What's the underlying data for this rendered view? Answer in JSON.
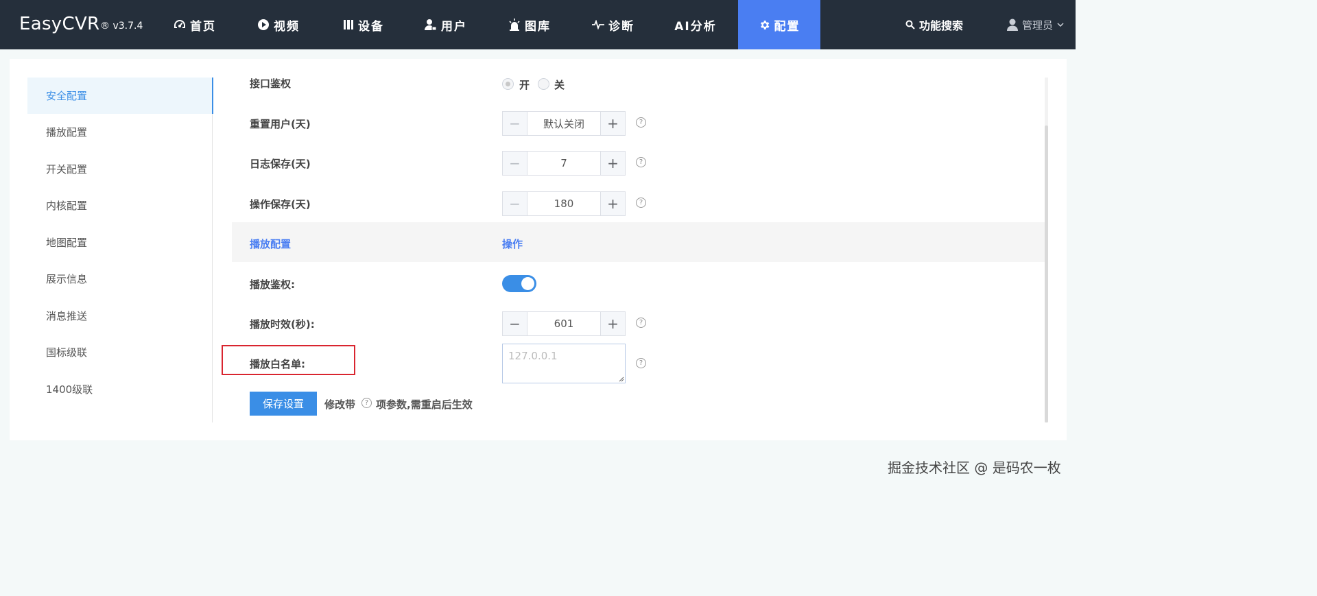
{
  "brand": {
    "name": "EasyCVR",
    "version": "® v3.7.4"
  },
  "nav": {
    "items": [
      {
        "label": "首页",
        "icon": "dashboard-icon"
      },
      {
        "label": "视频",
        "icon": "play-circle-icon"
      },
      {
        "label": "设备",
        "icon": "device-columns-icon"
      },
      {
        "label": "用户",
        "icon": "user-lock-icon"
      },
      {
        "label": "图库",
        "icon": "alarm-light-icon"
      },
      {
        "label": "诊断",
        "icon": "pulse-icon"
      },
      {
        "label": "AI分析",
        "icon": ""
      },
      {
        "label": "配置",
        "icon": "gear-icon",
        "active": true
      }
    ],
    "search_label": "功能搜索",
    "user_label": "管理员"
  },
  "sidebar": {
    "items": [
      {
        "label": "安全配置",
        "active": true
      },
      {
        "label": "播放配置"
      },
      {
        "label": "开关配置"
      },
      {
        "label": "内核配置"
      },
      {
        "label": "地图配置"
      },
      {
        "label": "展示信息"
      },
      {
        "label": "消息推送"
      },
      {
        "label": "国标级联"
      },
      {
        "label": "1400级联"
      }
    ]
  },
  "form": {
    "api_auth": {
      "label": "接口鉴权",
      "on_label": "开",
      "off_label": "关",
      "selected": "开"
    },
    "reset_user": {
      "label": "重置用户(天)",
      "value": "默认关闭"
    },
    "log_keep": {
      "label": "日志保存(天)",
      "value": "7"
    },
    "op_keep": {
      "label": "操作保存(天)",
      "value": "180"
    },
    "section": {
      "title": "播放配置",
      "action": "操作"
    },
    "play_auth": {
      "label": "播放鉴权:",
      "enabled": true
    },
    "play_timeout": {
      "label": "播放时效(秒):",
      "value": "601"
    },
    "play_whitelist": {
      "label": "播放白名单:",
      "placeholder": "127.0.0.1"
    },
    "save_label": "保存设置",
    "note_prefix": "修改带",
    "note_suffix": "项参数,需重启后生效",
    "minus": "−",
    "plus": "+",
    "help": "?"
  },
  "watermark": "掘金技术社区 @ 是码农一枚",
  "colors": {
    "nav_bg": "#252f3b",
    "accent": "#4a7ef2",
    "primary": "#3a8ee6",
    "highlight": "#d9252f"
  }
}
